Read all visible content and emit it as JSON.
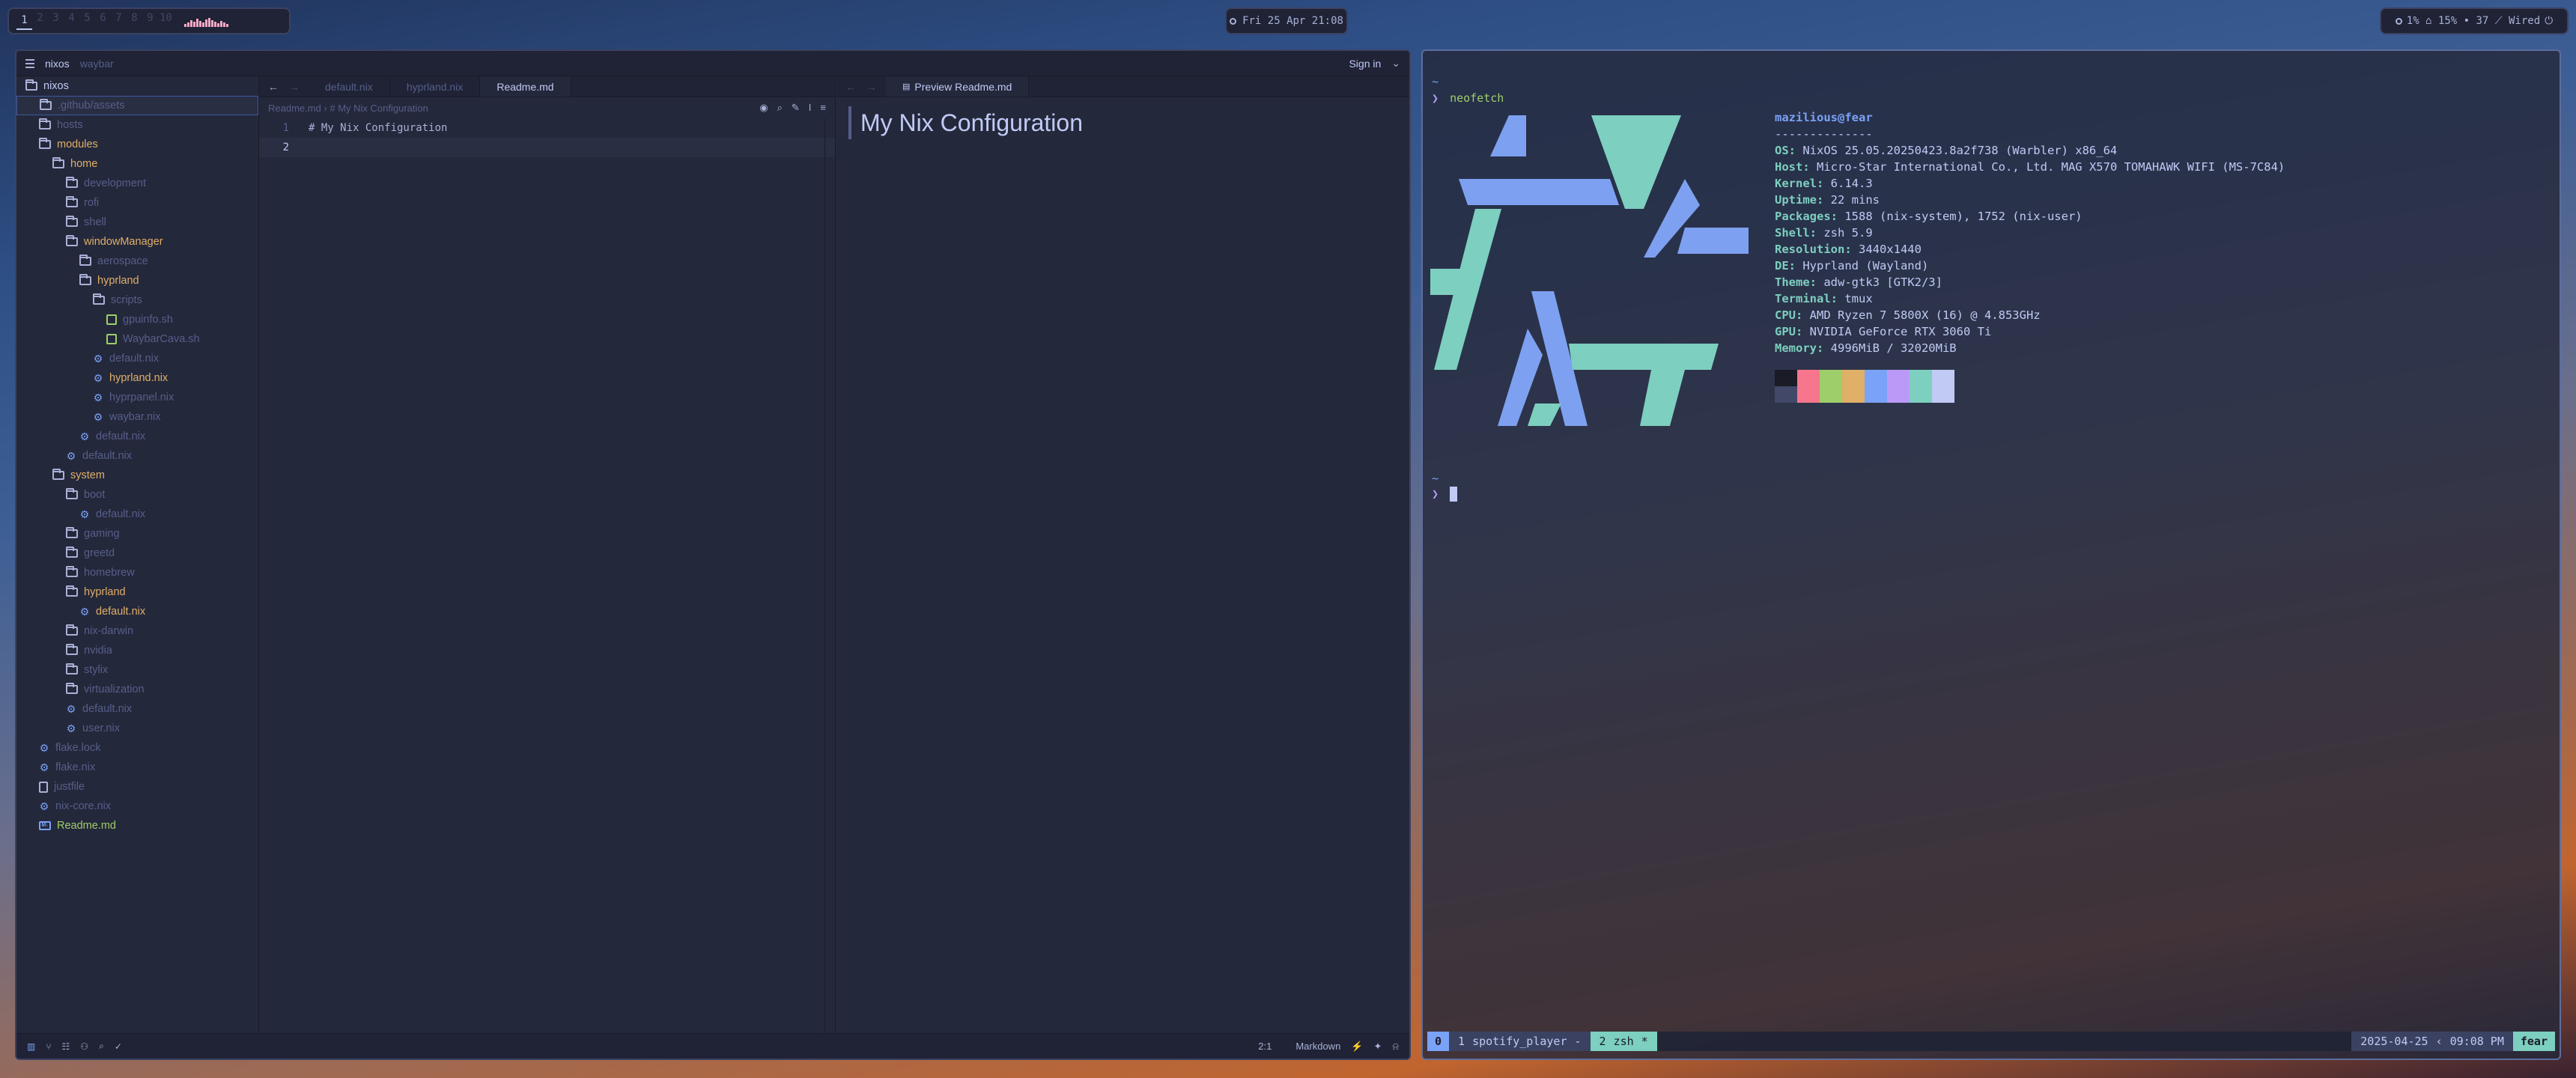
{
  "topbar": {
    "workspaces": [
      "1",
      "2",
      "3",
      "4",
      "5",
      "6",
      "7",
      "8",
      "9",
      "10"
    ],
    "active_workspace": "1",
    "clock": "Fri 25 Apr 21:08",
    "status": "1% ⌂ 15% • 37 ⟋ Wired"
  },
  "editor": {
    "project": "nixos",
    "branch": "waybar",
    "sign_in": "Sign in",
    "tree": [
      {
        "label": "nixos",
        "type": "folder",
        "depth": 0,
        "style": "bright"
      },
      {
        "label": ".github/assets",
        "type": "folder",
        "depth": 1,
        "style": "dim",
        "selected": true
      },
      {
        "label": "hosts",
        "type": "folder",
        "depth": 1,
        "style": "dim"
      },
      {
        "label": "modules",
        "type": "folder",
        "depth": 1,
        "style": "yellow"
      },
      {
        "label": "home",
        "type": "folder",
        "depth": 2,
        "style": "yellow"
      },
      {
        "label": "development",
        "type": "folder",
        "depth": 3,
        "style": "dim"
      },
      {
        "label": "rofi",
        "type": "folder",
        "depth": 3,
        "style": "dim"
      },
      {
        "label": "shell",
        "type": "folder",
        "depth": 3,
        "style": "dim"
      },
      {
        "label": "windowManager",
        "type": "folder",
        "depth": 3,
        "style": "yellow"
      },
      {
        "label": "aerospace",
        "type": "folder",
        "depth": 4,
        "style": "dim"
      },
      {
        "label": "hyprland",
        "type": "folder",
        "depth": 4,
        "style": "yellow"
      },
      {
        "label": "scripts",
        "type": "folder",
        "depth": 5,
        "style": "dim"
      },
      {
        "label": "gpuinfo.sh",
        "type": "script",
        "depth": 6,
        "style": "dim"
      },
      {
        "label": "WaybarCava.sh",
        "type": "script",
        "depth": 6,
        "style": "dim"
      },
      {
        "label": "default.nix",
        "type": "nix",
        "depth": 5,
        "style": "dim"
      },
      {
        "label": "hyprland.nix",
        "type": "nix",
        "depth": 5,
        "style": "yellow"
      },
      {
        "label": "hyprpanel.nix",
        "type": "nix",
        "depth": 5,
        "style": "dim"
      },
      {
        "label": "waybar.nix",
        "type": "nix",
        "depth": 5,
        "style": "dim"
      },
      {
        "label": "default.nix",
        "type": "nix",
        "depth": 4,
        "style": "dim"
      },
      {
        "label": "default.nix",
        "type": "nix",
        "depth": 3,
        "style": "dim"
      },
      {
        "label": "system",
        "type": "folder",
        "depth": 2,
        "style": "yellow"
      },
      {
        "label": "boot",
        "type": "folder",
        "depth": 3,
        "style": "dim"
      },
      {
        "label": "default.nix",
        "type": "nix",
        "depth": 4,
        "style": "dim"
      },
      {
        "label": "gaming",
        "type": "folder",
        "depth": 3,
        "style": "dim"
      },
      {
        "label": "greetd",
        "type": "folder",
        "depth": 3,
        "style": "dim"
      },
      {
        "label": "homebrew",
        "type": "folder",
        "depth": 3,
        "style": "dim"
      },
      {
        "label": "hyprland",
        "type": "folder",
        "depth": 3,
        "style": "yellow"
      },
      {
        "label": "default.nix",
        "type": "nix",
        "depth": 4,
        "style": "yellow"
      },
      {
        "label": "nix-darwin",
        "type": "folder",
        "depth": 3,
        "style": "dim"
      },
      {
        "label": "nvidia",
        "type": "folder",
        "depth": 3,
        "style": "dim"
      },
      {
        "label": "stylix",
        "type": "folder",
        "depth": 3,
        "style": "dim"
      },
      {
        "label": "virtualization",
        "type": "folder",
        "depth": 3,
        "style": "dim"
      },
      {
        "label": "default.nix",
        "type": "nix",
        "depth": 3,
        "style": "dim"
      },
      {
        "label": "user.nix",
        "type": "nix",
        "depth": 3,
        "style": "dim"
      },
      {
        "label": "flake.lock",
        "type": "nix",
        "depth": 1,
        "style": "dim"
      },
      {
        "label": "flake.nix",
        "type": "nix",
        "depth": 1,
        "style": "dim"
      },
      {
        "label": "justfile",
        "type": "file",
        "depth": 1,
        "style": "dim"
      },
      {
        "label": "nix-core.nix",
        "type": "nix",
        "depth": 1,
        "style": "dim"
      },
      {
        "label": "Readme.md",
        "type": "md",
        "depth": 1,
        "style": "green"
      }
    ],
    "tabs": [
      "default.nix",
      "hyprland.nix",
      "Readme.md"
    ],
    "active_tab": "Readme.md",
    "breadcrumb": "Readme.md › # My Nix Configuration",
    "lines": [
      {
        "num": "1",
        "text": "# My Nix Configuration"
      },
      {
        "num": "2",
        "text": ""
      }
    ],
    "preview_tab": "Preview Readme.md",
    "preview_heading": "My Nix Configuration",
    "cursor_pos": "2:1",
    "language": "Markdown"
  },
  "terminal": {
    "prompt_dir": "~",
    "prompt_char": "❯",
    "command": "neofetch",
    "user_host": "mazilious@fear",
    "separator": "--------------",
    "info": [
      {
        "key": "OS",
        "value": "NixOS 25.05.20250423.8a2f738 (Warbler) x86_64"
      },
      {
        "key": "Host",
        "value": "Micro-Star International Co., Ltd. MAG X570 TOMAHAWK WIFI (MS-7C84)"
      },
      {
        "key": "Kernel",
        "value": "6.14.3"
      },
      {
        "key": "Uptime",
        "value": "22 mins"
      },
      {
        "key": "Packages",
        "value": "1588 (nix-system), 1752 (nix-user)"
      },
      {
        "key": "Shell",
        "value": "zsh 5.9"
      },
      {
        "key": "Resolution",
        "value": "3440x1440"
      },
      {
        "key": "DE",
        "value": "Hyprland (Wayland)"
      },
      {
        "key": "Theme",
        "value": "adw-gtk3 [GTK2/3]"
      },
      {
        "key": "Terminal",
        "value": "tmux"
      },
      {
        "key": "CPU",
        "value": "AMD Ryzen 7 5800X (16) @ 4.853GHz"
      },
      {
        "key": "GPU",
        "value": "NVIDIA GeForce RTX 3060 Ti"
      },
      {
        "key": "Memory",
        "value": "4996MiB / 32020MiB"
      }
    ],
    "palette_top": [
      "#1a1b26",
      "#f7768e",
      "#9ece6a",
      "#e0af68",
      "#7aa2f7",
      "#bb9af7",
      "#7dcfc0",
      "#c0caf5"
    ],
    "palette_bottom": [
      "#414868",
      "#f7768e",
      "#9ece6a",
      "#e0af68",
      "#7aa2f7",
      "#bb9af7",
      "#7dcfc0",
      "#c0caf5"
    ],
    "tmux": {
      "session": "0",
      "windows": [
        {
          "index": "1",
          "name": "spotify_player",
          "flag": "-"
        },
        {
          "index": "2",
          "name": "zsh",
          "flag": "*"
        }
      ],
      "date": "2025-04-25",
      "time": "09:08 PM",
      "host": "fear"
    }
  }
}
